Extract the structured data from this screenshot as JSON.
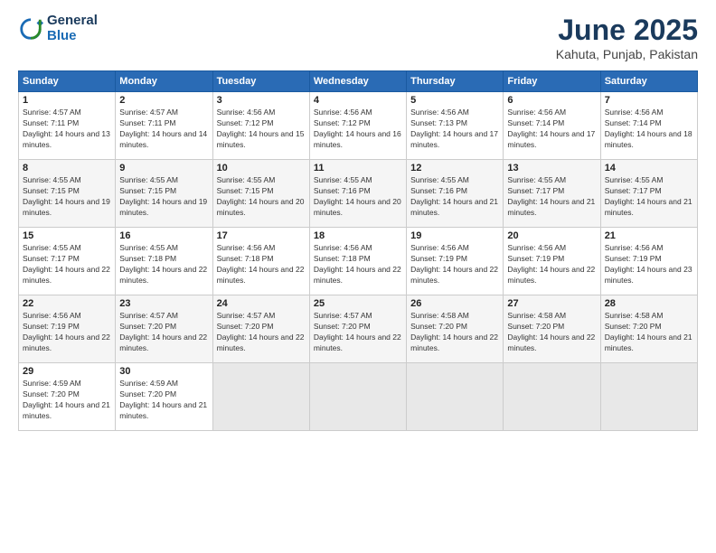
{
  "header": {
    "logo_line1": "General",
    "logo_line2": "Blue",
    "month": "June 2025",
    "location": "Kahuta, Punjab, Pakistan"
  },
  "days_of_week": [
    "Sunday",
    "Monday",
    "Tuesday",
    "Wednesday",
    "Thursday",
    "Friday",
    "Saturday"
  ],
  "weeks": [
    [
      {
        "day": "1",
        "sunrise": "4:57 AM",
        "sunset": "7:11 PM",
        "daylight": "14 hours and 13 minutes."
      },
      {
        "day": "2",
        "sunrise": "4:57 AM",
        "sunset": "7:11 PM",
        "daylight": "14 hours and 14 minutes."
      },
      {
        "day": "3",
        "sunrise": "4:56 AM",
        "sunset": "7:12 PM",
        "daylight": "14 hours and 15 minutes."
      },
      {
        "day": "4",
        "sunrise": "4:56 AM",
        "sunset": "7:12 PM",
        "daylight": "14 hours and 16 minutes."
      },
      {
        "day": "5",
        "sunrise": "4:56 AM",
        "sunset": "7:13 PM",
        "daylight": "14 hours and 17 minutes."
      },
      {
        "day": "6",
        "sunrise": "4:56 AM",
        "sunset": "7:14 PM",
        "daylight": "14 hours and 17 minutes."
      },
      {
        "day": "7",
        "sunrise": "4:56 AM",
        "sunset": "7:14 PM",
        "daylight": "14 hours and 18 minutes."
      }
    ],
    [
      {
        "day": "8",
        "sunrise": "4:55 AM",
        "sunset": "7:15 PM",
        "daylight": "14 hours and 19 minutes."
      },
      {
        "day": "9",
        "sunrise": "4:55 AM",
        "sunset": "7:15 PM",
        "daylight": "14 hours and 19 minutes."
      },
      {
        "day": "10",
        "sunrise": "4:55 AM",
        "sunset": "7:15 PM",
        "daylight": "14 hours and 20 minutes."
      },
      {
        "day": "11",
        "sunrise": "4:55 AM",
        "sunset": "7:16 PM",
        "daylight": "14 hours and 20 minutes."
      },
      {
        "day": "12",
        "sunrise": "4:55 AM",
        "sunset": "7:16 PM",
        "daylight": "14 hours and 21 minutes."
      },
      {
        "day": "13",
        "sunrise": "4:55 AM",
        "sunset": "7:17 PM",
        "daylight": "14 hours and 21 minutes."
      },
      {
        "day": "14",
        "sunrise": "4:55 AM",
        "sunset": "7:17 PM",
        "daylight": "14 hours and 21 minutes."
      }
    ],
    [
      {
        "day": "15",
        "sunrise": "4:55 AM",
        "sunset": "7:17 PM",
        "daylight": "14 hours and 22 minutes."
      },
      {
        "day": "16",
        "sunrise": "4:55 AM",
        "sunset": "7:18 PM",
        "daylight": "14 hours and 22 minutes."
      },
      {
        "day": "17",
        "sunrise": "4:56 AM",
        "sunset": "7:18 PM",
        "daylight": "14 hours and 22 minutes."
      },
      {
        "day": "18",
        "sunrise": "4:56 AM",
        "sunset": "7:18 PM",
        "daylight": "14 hours and 22 minutes."
      },
      {
        "day": "19",
        "sunrise": "4:56 AM",
        "sunset": "7:19 PM",
        "daylight": "14 hours and 22 minutes."
      },
      {
        "day": "20",
        "sunrise": "4:56 AM",
        "sunset": "7:19 PM",
        "daylight": "14 hours and 22 minutes."
      },
      {
        "day": "21",
        "sunrise": "4:56 AM",
        "sunset": "7:19 PM",
        "daylight": "14 hours and 23 minutes."
      }
    ],
    [
      {
        "day": "22",
        "sunrise": "4:56 AM",
        "sunset": "7:19 PM",
        "daylight": "14 hours and 22 minutes."
      },
      {
        "day": "23",
        "sunrise": "4:57 AM",
        "sunset": "7:20 PM",
        "daylight": "14 hours and 22 minutes."
      },
      {
        "day": "24",
        "sunrise": "4:57 AM",
        "sunset": "7:20 PM",
        "daylight": "14 hours and 22 minutes."
      },
      {
        "day": "25",
        "sunrise": "4:57 AM",
        "sunset": "7:20 PM",
        "daylight": "14 hours and 22 minutes."
      },
      {
        "day": "26",
        "sunrise": "4:58 AM",
        "sunset": "7:20 PM",
        "daylight": "14 hours and 22 minutes."
      },
      {
        "day": "27",
        "sunrise": "4:58 AM",
        "sunset": "7:20 PM",
        "daylight": "14 hours and 22 minutes."
      },
      {
        "day": "28",
        "sunrise": "4:58 AM",
        "sunset": "7:20 PM",
        "daylight": "14 hours and 21 minutes."
      }
    ],
    [
      {
        "day": "29",
        "sunrise": "4:59 AM",
        "sunset": "7:20 PM",
        "daylight": "14 hours and 21 minutes."
      },
      {
        "day": "30",
        "sunrise": "4:59 AM",
        "sunset": "7:20 PM",
        "daylight": "14 hours and 21 minutes."
      },
      null,
      null,
      null,
      null,
      null
    ]
  ]
}
